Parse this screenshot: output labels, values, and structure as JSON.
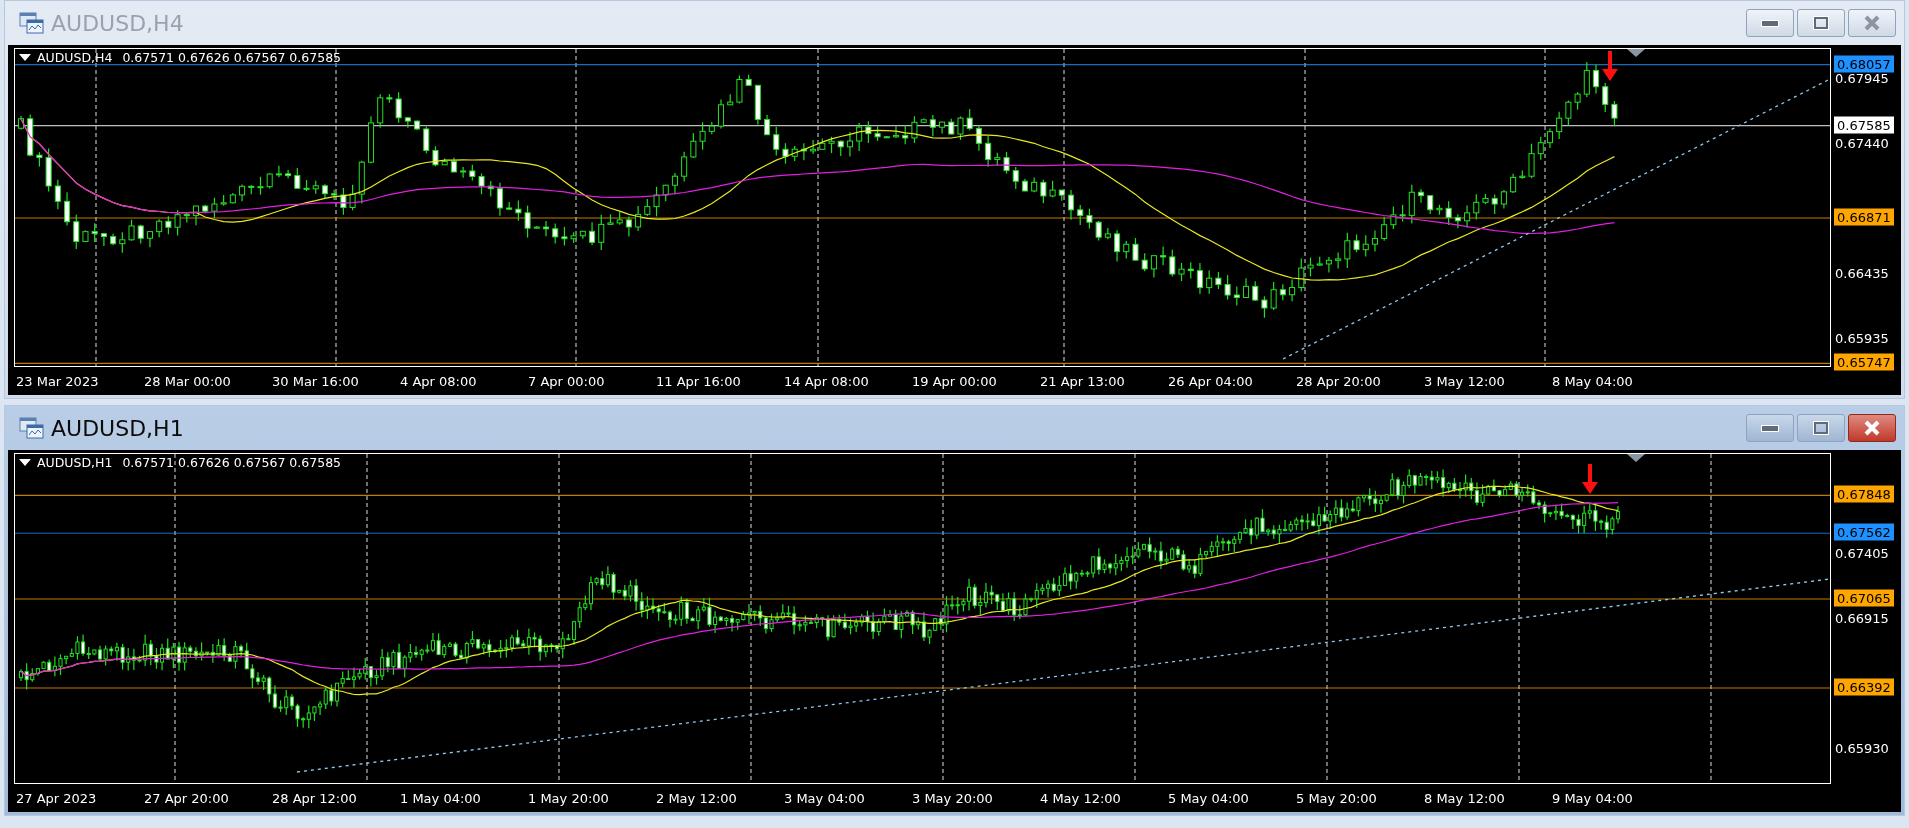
{
  "windows": [
    {
      "title": "AUDUSD,H4",
      "active": false,
      "info": {
        "symbol": "AUDUSD,H4",
        "ohlc": "0.67571 0.67626 0.67567 0.67585"
      },
      "price_ticks": [
        "0.67945",
        "0.67440",
        "0.66435",
        "0.65935"
      ],
      "price_tags": [
        {
          "label": "0.68057",
          "color": "#1e90ff"
        },
        {
          "label": "0.67585",
          "color": "#ffffff"
        },
        {
          "label": "0.66871",
          "color": "#ffa500"
        },
        {
          "label": "0.65747",
          "color": "#ffa500"
        }
      ],
      "time_labels": [
        "23 Mar 2023",
        "28 Mar 00:00",
        "30 Mar 16:00",
        "4 Apr 08:00",
        "7 Apr 00:00",
        "11 Apr 16:00",
        "14 Apr 08:00",
        "19 Apr 00:00",
        "21 Apr 13:00",
        "26 Apr 04:00",
        "28 Apr 20:00",
        "3 May 12:00",
        "8 May 04:00"
      ]
    },
    {
      "title": "AUDUSD,H1",
      "active": true,
      "info": {
        "symbol": "AUDUSD,H1",
        "ohlc": "0.67571 0.67626 0.67567 0.67585"
      },
      "price_ticks": [
        "0.67405",
        "0.66915",
        "0.65930"
      ],
      "price_tags": [
        {
          "label": "0.67848",
          "color": "#ffa500"
        },
        {
          "label": "0.67562",
          "color": "#1e90ff"
        },
        {
          "label": "0.67065",
          "color": "#ffa500"
        },
        {
          "label": "0.66392",
          "color": "#ffa500"
        }
      ],
      "time_labels": [
        "27 Apr 2023",
        "27 Apr 20:00",
        "28 Apr 12:00",
        "1 May 04:00",
        "1 May 20:00",
        "2 May 12:00",
        "3 May 04:00",
        "3 May 20:00",
        "4 May 12:00",
        "5 May 04:00",
        "5 May 20:00",
        "8 May 12:00",
        "9 May 04:00"
      ]
    }
  ]
}
